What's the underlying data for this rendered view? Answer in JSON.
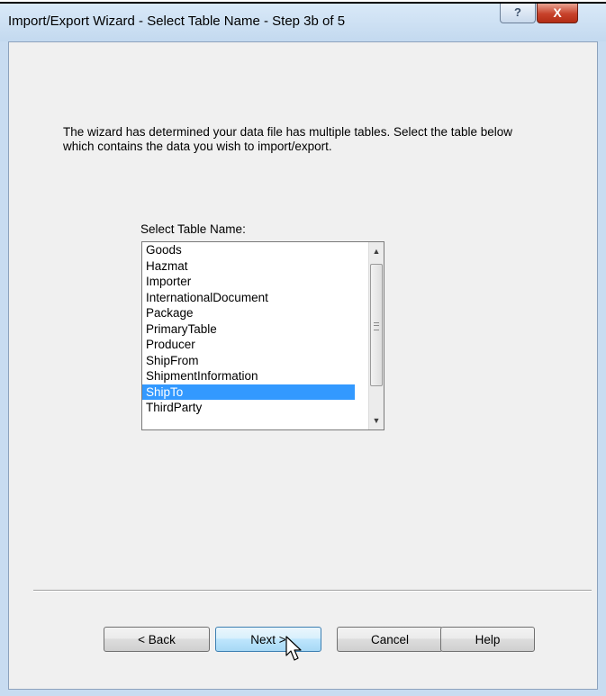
{
  "window": {
    "title": "Import/Export Wizard - Select Table Name - Step 3b of 5",
    "help_glyph": "?",
    "close_glyph": "X"
  },
  "intro_text": "The wizard has determined your data file has multiple tables. Select the table below which contains the data you wish to import/export.",
  "listbox": {
    "label": "Select Table Name:",
    "items": [
      "Goods",
      "Hazmat",
      "Importer",
      "InternationalDocument",
      "Package",
      "PrimaryTable",
      "Producer",
      "ShipFrom",
      "ShipmentInformation",
      "ShipTo",
      "ThirdParty"
    ],
    "selected": "ShipTo",
    "scroll_up_glyph": "▲",
    "scroll_down_glyph": "▼"
  },
  "buttons": {
    "back": "< Back",
    "next": "Next >",
    "cancel": "Cancel",
    "help": "Help"
  },
  "colors": {
    "selection": "#3399ff",
    "title_bar": "#c8dcf1",
    "close_button": "#c7412a"
  }
}
